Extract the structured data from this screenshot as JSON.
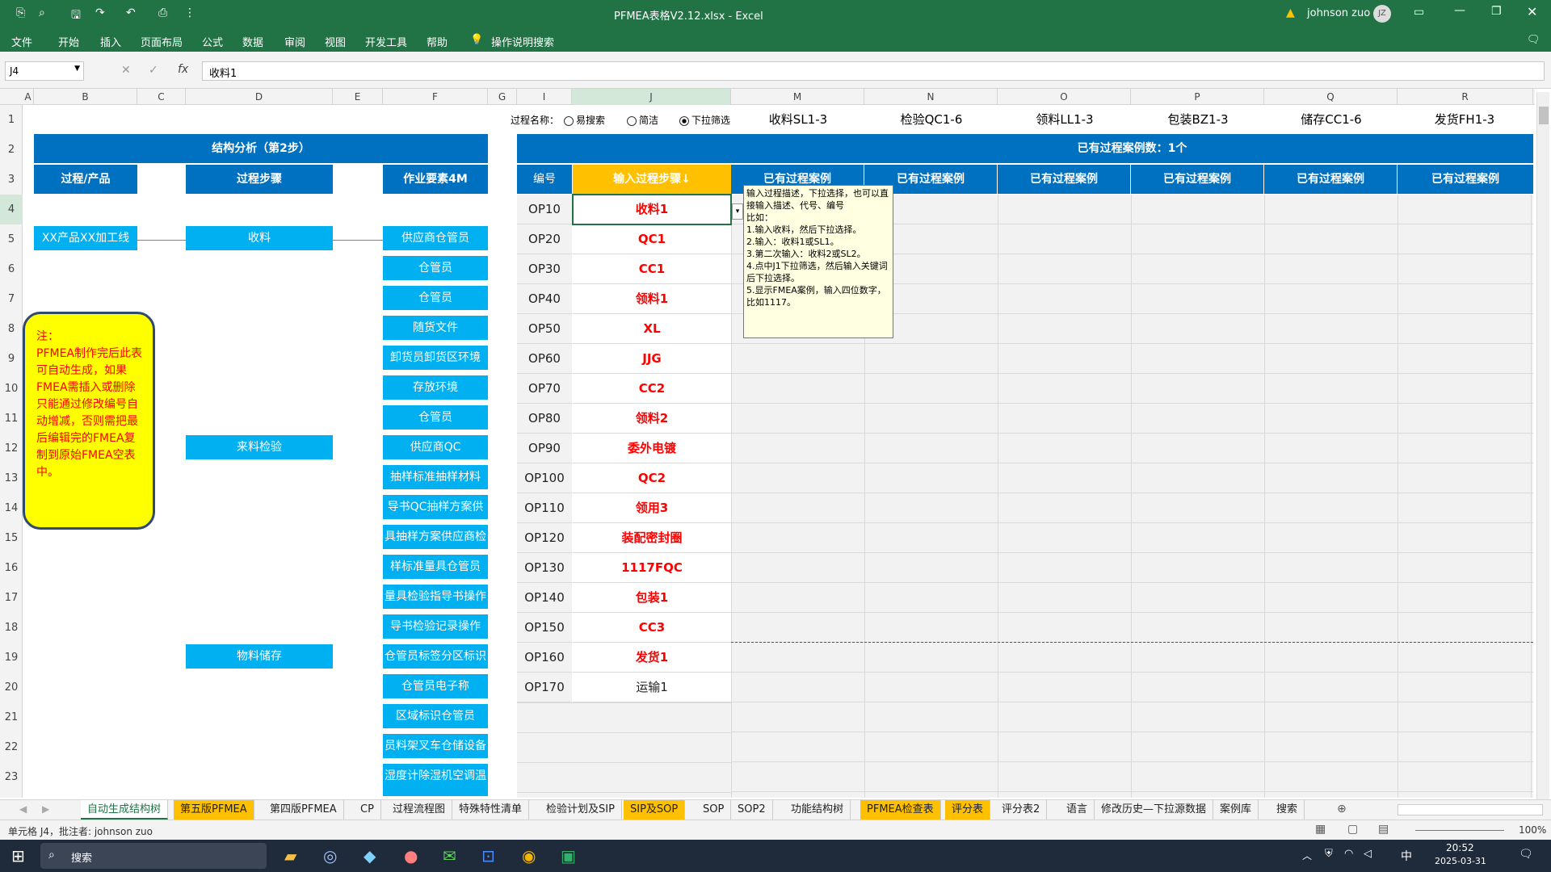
{
  "window": {
    "title": "PFMEA表格V2.12.xlsx  -  Excel",
    "user": "johnson zuo",
    "avatar": "JZ"
  },
  "menu": [
    "文件",
    "开始",
    "插入",
    "页面布局",
    "公式",
    "数据",
    "审阅",
    "视图",
    "开发工具",
    "帮助",
    "操作说明搜索"
  ],
  "formula_bar": {
    "cell_ref": "J4",
    "value": "收料1"
  },
  "columns": [
    "A",
    "B",
    "C",
    "D",
    "E",
    "F",
    "G",
    "I",
    "J",
    "M",
    "N",
    "O",
    "P",
    "Q",
    "R"
  ],
  "rows": [
    "1",
    "2",
    "3",
    "4",
    "5",
    "6",
    "7",
    "8",
    "9",
    "10",
    "11",
    "12",
    "13",
    "14",
    "15",
    "16",
    "17",
    "18",
    "19",
    "20",
    "21",
    "22",
    "23"
  ],
  "structure": {
    "title": "结构分析（第2步）",
    "headers": [
      "过程/产品",
      "过程步骤",
      "作业要素4M"
    ],
    "product": "XX产品XX加工线",
    "steps": [
      "收料",
      "来料检验",
      "物料储存"
    ],
    "elements": [
      "供应商仓管员",
      "仓管员",
      "仓管员",
      "随货文件",
      "卸货员卸货区环境",
      "存放环境",
      "仓管员",
      "供应商QC",
      "抽样标准抽样材料",
      "导书QC抽样方案供",
      "具抽样方案供应商检",
      "样标准量具仓管员",
      "量具检验指导书操作",
      "导书检验记录操作",
      "仓管员标签分区标识",
      "仓管员电子称",
      "区域标识仓管员",
      "员料架叉车仓储设备",
      "湿度计除湿机空调温"
    ]
  },
  "note": "注：\nPFMEA制作完后此表可自动生成，如果FMEA需插入或删除只能通过修改编号自动增减，否则需把最后编辑完的FMEA复制到原始FMEA空表中。",
  "process": {
    "label": "过程名称：",
    "radios": [
      "易搜索",
      "简洁",
      "下拉筛选"
    ],
    "selected_radio": "下拉筛选",
    "headers_row1": [
      "收料SL1-3",
      "检验QC1-6",
      "领料LL1-3",
      "包装BZ1-3",
      "储存CC1-6",
      "发货FH1-3"
    ],
    "case_count": "已有过程案例数：1个",
    "col_no": "编号",
    "col_input": "输入过程步骤↓",
    "case_header": "已有过程案例",
    "items": [
      {
        "no": "OP10",
        "step": "收料1",
        "color": "#ff0000"
      },
      {
        "no": "OP20",
        "step": "QC1",
        "color": "#ff0000"
      },
      {
        "no": "OP30",
        "step": "CC1",
        "color": "#ff0000"
      },
      {
        "no": "OP40",
        "step": "领料1",
        "color": "#ff0000"
      },
      {
        "no": "OP50",
        "step": "XL",
        "color": "#ff0000"
      },
      {
        "no": "OP60",
        "step": "JJG",
        "color": "#ff0000"
      },
      {
        "no": "OP70",
        "step": "CC2",
        "color": "#ff0000"
      },
      {
        "no": "OP80",
        "step": "领料2",
        "color": "#ff0000"
      },
      {
        "no": "OP90",
        "step": "委外电镀",
        "color": "#ff0000"
      },
      {
        "no": "OP100",
        "step": "QC2",
        "color": "#ff0000"
      },
      {
        "no": "OP110",
        "step": "领用3",
        "color": "#ff0000"
      },
      {
        "no": "OP120",
        "step": "装配密封圈",
        "color": "#ff0000"
      },
      {
        "no": "OP130",
        "step": "1117FQC",
        "color": "#ff0000"
      },
      {
        "no": "OP140",
        "step": "包装1",
        "color": "#ff0000"
      },
      {
        "no": "OP150",
        "step": "CC3",
        "color": "#ff0000"
      },
      {
        "no": "OP160",
        "step": "发货1",
        "color": "#ff0000"
      },
      {
        "no": "OP170",
        "step": "运输1",
        "color": "#222222"
      }
    ]
  },
  "tooltip": "输入过程描述，下拉选择，也可以直接输入描述、代号、编号\n比如：\n1.输入收料，然后下拉选择。\n2.输入：收料1或SL1。\n3.第二次输入：收料2或SL2。\n4.点中J1下拉筛选，然后输入关键词后下拉选择。\n5.显示FMEA案例，输入四位数字，比如1117。",
  "sheet_tabs": [
    "自动生成结构树",
    "第五版PFMEA",
    "第四版PFMEA",
    "CP",
    "过程流程图",
    "特殊特性清单",
    "检验计划及SIP",
    "SIP及SOP",
    "SOP",
    "SOP2",
    "功能结构树",
    "PFMEA检查表",
    "评分表",
    "评分表2",
    "语言",
    "修改历史—下拉源数据",
    "案例库",
    "搜索"
  ],
  "status": {
    "text": "单元格 J4，批注者: johnson zuo",
    "zoom": "100%"
  },
  "taskbar": {
    "search": "搜索",
    "time": "20:52",
    "date": "2025-03-31",
    "ime": "中"
  }
}
